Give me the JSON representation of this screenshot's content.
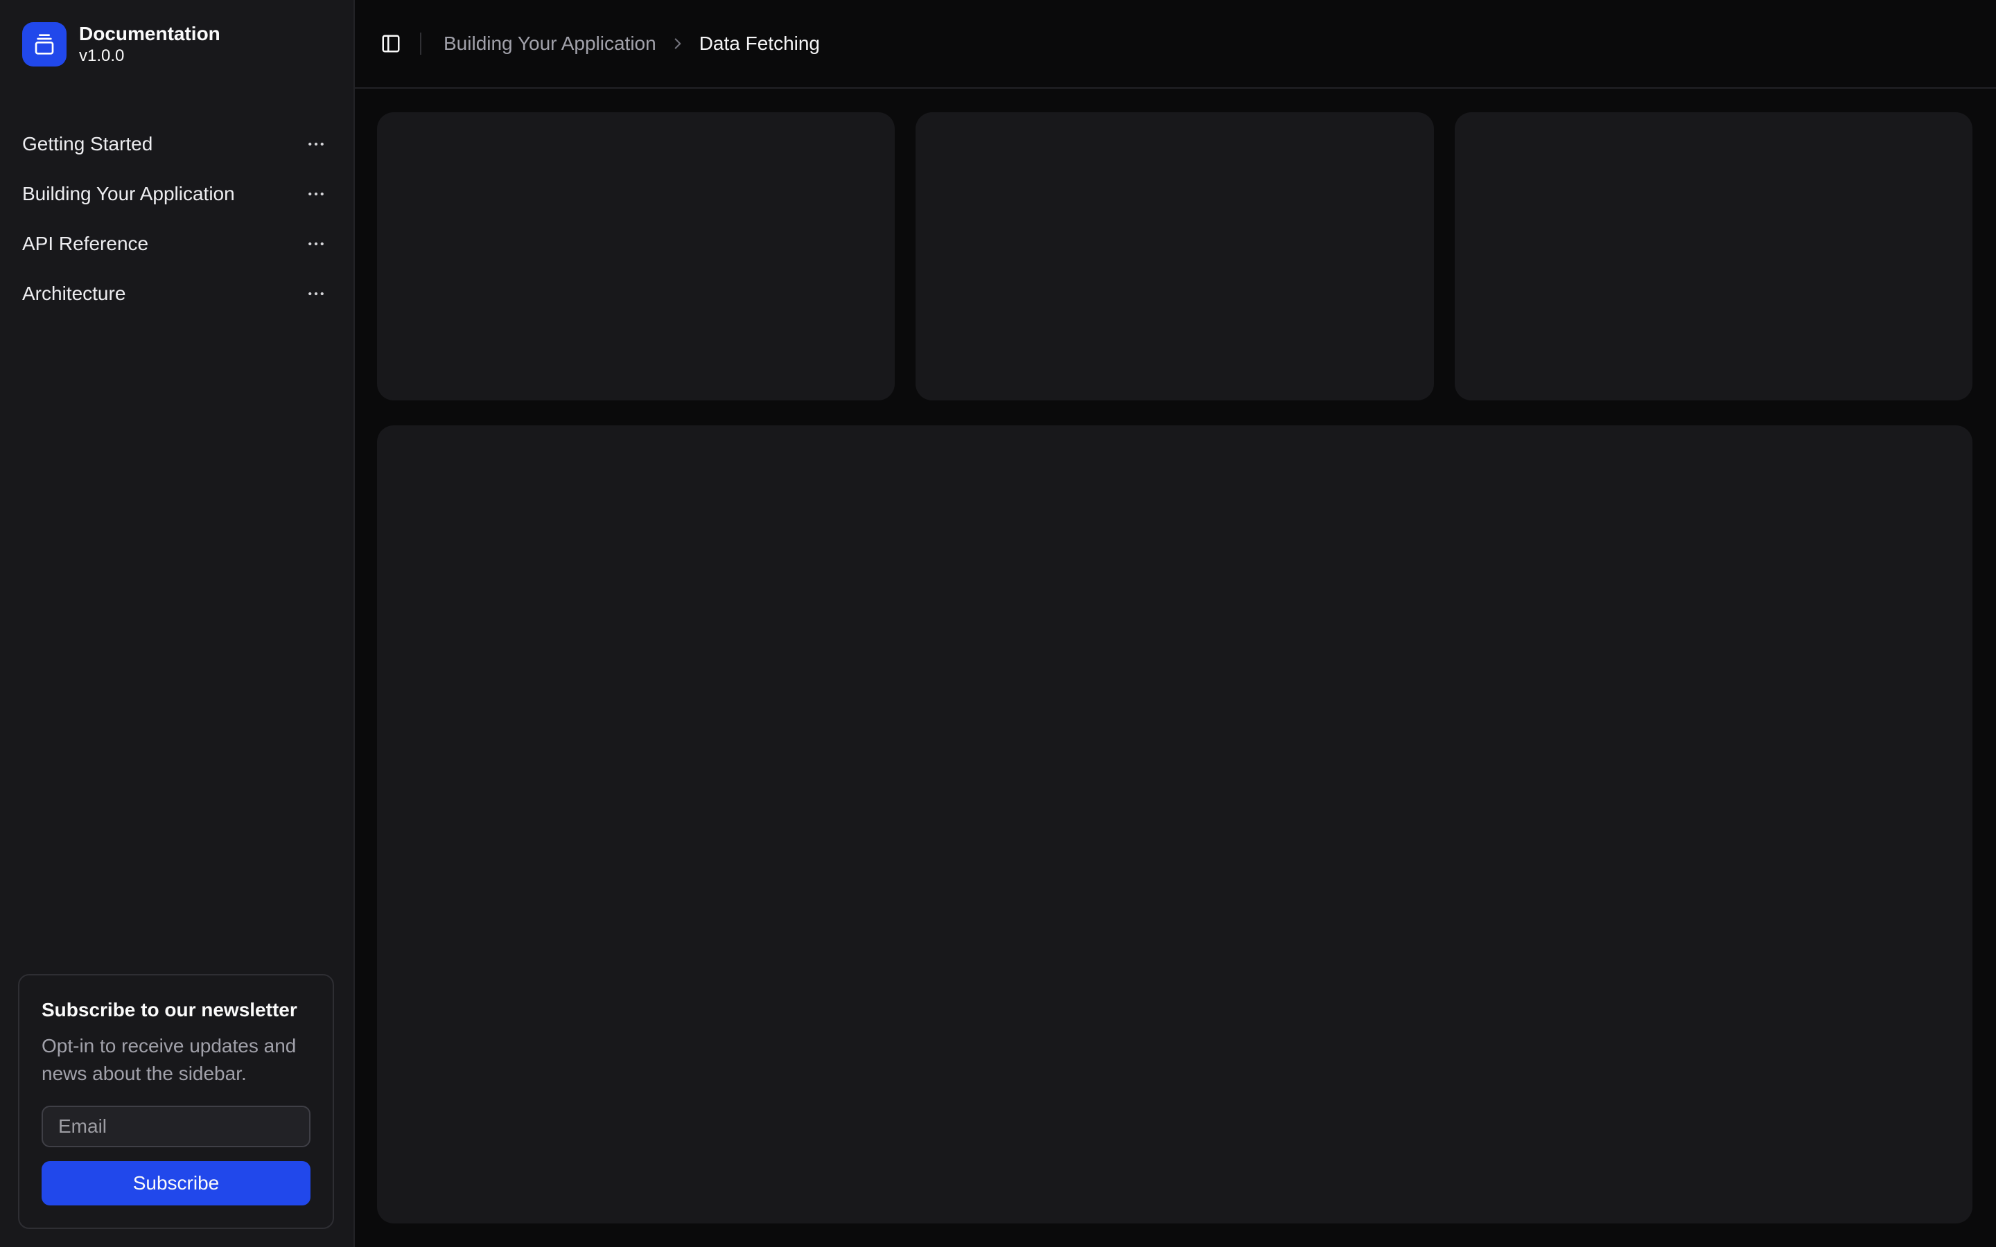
{
  "sidebar": {
    "header": {
      "title": "Documentation",
      "version": "v1.0.0"
    },
    "items": [
      {
        "label": "Getting Started"
      },
      {
        "label": "Building Your Application"
      },
      {
        "label": "API Reference"
      },
      {
        "label": "Architecture"
      }
    ],
    "newsletter": {
      "title": "Subscribe to our newsletter",
      "description": "Opt-in to receive updates and news about the sidebar.",
      "email_placeholder": "Email",
      "email_value": "",
      "subscribe_label": "Subscribe"
    }
  },
  "header": {
    "breadcrumb": {
      "parent": "Building Your Application",
      "current": "Data Fetching"
    }
  },
  "icons": {
    "logo": "gallery-vertical-end-icon",
    "menu_action": "more-horizontal-icon",
    "toggle": "panel-left-icon",
    "breadcrumb_separator": "chevron-right-icon"
  },
  "colors": {
    "brand_blue": "#2148eb",
    "sidebar_bg": "#18181b",
    "main_bg": "#0a0a0b",
    "card_bg": "#18181b",
    "primary_text": "#fafafa",
    "muted_text": "#a1a1aa",
    "border": "#2e2e33"
  }
}
